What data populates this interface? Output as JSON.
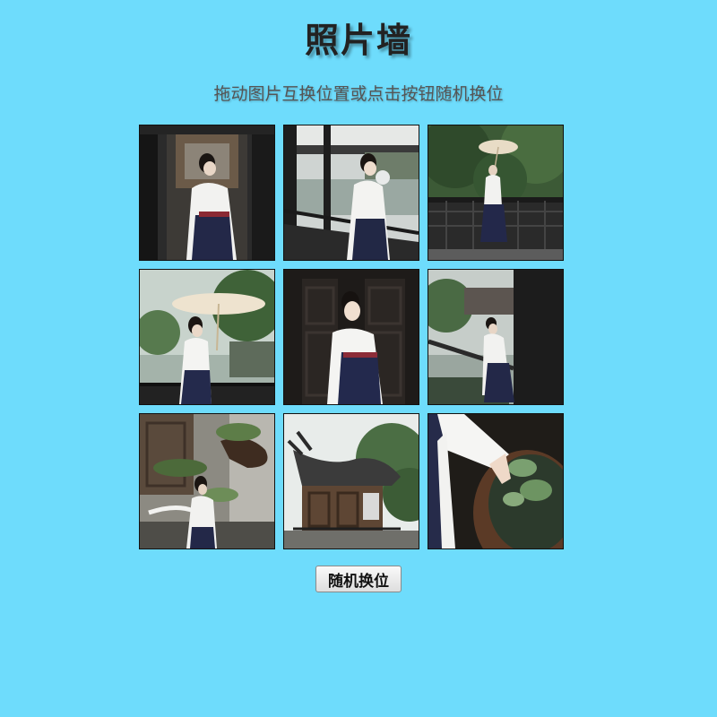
{
  "header": {
    "title": "照片墙",
    "subtitle": "拖动图片互换位置或点击按钮随机换位"
  },
  "gallery": {
    "photos": [
      {
        "icon": "photo-woman-corridor-icon"
      },
      {
        "icon": "photo-woman-railing-fan-icon"
      },
      {
        "icon": "photo-woman-umbrella-terrace-icon"
      },
      {
        "icon": "photo-woman-umbrella-pond-icon"
      },
      {
        "icon": "photo-woman-wooden-door-icon"
      },
      {
        "icon": "photo-woman-looking-up-corridor-icon"
      },
      {
        "icon": "photo-woman-bonsai-tree-icon"
      },
      {
        "icon": "photo-pavilion-roof-icon"
      },
      {
        "icon": "photo-hand-lotus-bowl-icon"
      }
    ]
  },
  "controls": {
    "shuffle_label": "随机换位"
  },
  "colors": {
    "background": "#6edcfc",
    "title": "#222222",
    "subtitle": "#555555"
  }
}
